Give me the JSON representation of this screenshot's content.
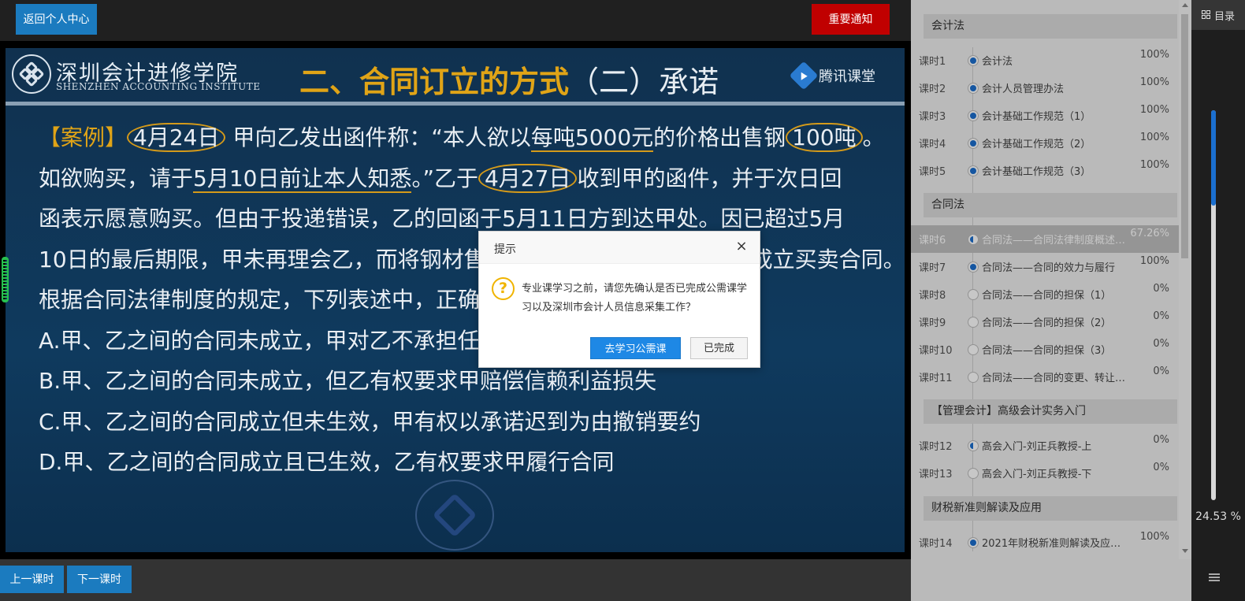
{
  "topbar": {
    "back_label": "返回个人中心",
    "notice_label": "重要通知"
  },
  "slide": {
    "institute_cn": "深圳会计进修学院",
    "institute_en": "SHENZHEN ACCOUNTING INSTITUTE",
    "title_main": "二、合同订立的方式",
    "title_sub": "（二）承诺",
    "brand": "腾讯课堂",
    "line1_tag": "【案例】",
    "line1_date": "4月24日",
    "line1_a": "甲向乙发出函件称：“本人欲以",
    "line1_price": "每吨5000元",
    "line1_b": "的价格出售钢",
    "line1_qty": "100吨",
    "line1_end": "。",
    "line2_a": "如欲购买，请于",
    "line2_deadline": "5月10日前让本人知悉",
    "line2_b": "。”乙于",
    "line2_date": "4月27日",
    "line2_c": "收到甲的函件，并于次日回",
    "line3": "函表示愿意购买。但由于投递错误，乙的回函于5月11日方到达甲处。因已超过5月",
    "line4": "10日的最后期限，甲未再理会乙，而将钢材售予丙。乙认为甲、乙之间已成立买卖合同。",
    "line5": "根据合同法律制度的规定，下列表述中，正确的是（ ）。",
    "option_a": "A.甲、乙之间的合同未成立，甲对乙不承担任何责任",
    "option_b": "B.甲、乙之间的合同未成立，但乙有权要求甲赔偿信赖利益损失",
    "option_c": "C.甲、乙之间的合同成立但未生效，甲有权以承诺迟到为由撤销要约",
    "option_d": "D.甲、乙之间的合同成立且已生效，乙有权要求甲履行合同"
  },
  "bottombar": {
    "prev_label": "上一课时",
    "next_label": "下一课时"
  },
  "playlist": {
    "sections": [
      {
        "title": "会计法",
        "lessons": [
          {
            "num": "课时1",
            "name": "会计法",
            "pct": "100%",
            "state": "full"
          },
          {
            "num": "课时2",
            "name": "会计人员管理办法",
            "pct": "100%",
            "state": "full"
          },
          {
            "num": "课时3",
            "name": "会计基础工作规范（1）",
            "pct": "100%",
            "state": "full"
          },
          {
            "num": "课时4",
            "name": "会计基础工作规范（2）",
            "pct": "100%",
            "state": "full"
          },
          {
            "num": "课时5",
            "name": "会计基础工作规范（3）",
            "pct": "100%",
            "state": "full"
          }
        ]
      },
      {
        "title": "合同法",
        "lessons": [
          {
            "num": "课时6",
            "name": "合同法——合同法律制度概述…",
            "pct": "67.26%",
            "state": "half"
          },
          {
            "num": "课时7",
            "name": "合同法——合同的效力与履行",
            "pct": "100%",
            "state": "full"
          },
          {
            "num": "课时8",
            "name": "合同法——合同的担保（1）",
            "pct": "0%",
            "state": "empty"
          },
          {
            "num": "课时9",
            "name": "合同法——合同的担保（2）",
            "pct": "0%",
            "state": "empty"
          },
          {
            "num": "课时10",
            "name": "合同法——合同的担保（3）",
            "pct": "0%",
            "state": "empty"
          },
          {
            "num": "课时11",
            "name": "合同法——合同的变更、转让…",
            "pct": "0%",
            "state": "empty"
          }
        ]
      },
      {
        "title": "【管理会计】高级会计实务入门",
        "lessons": [
          {
            "num": "课时12",
            "name": "高会入门-刘正兵教授-上",
            "pct": "0%",
            "state": "half"
          },
          {
            "num": "课时13",
            "name": "高会入门-刘正兵教授-下",
            "pct": "0%",
            "state": "empty"
          }
        ]
      },
      {
        "title": "财税新准则解读及应用",
        "lessons": [
          {
            "num": "课时14",
            "name": "2021年财税新准则解读及应…",
            "pct": "100%",
            "state": "full"
          }
        ]
      }
    ]
  },
  "rightstrip": {
    "toc_label": "目录",
    "overall_progress": "24.53 %",
    "overall_fraction": 0.2453
  },
  "dialog": {
    "title": "提示",
    "close_glyph": "×",
    "icon_glyph": "?",
    "message": "专业课学习之前，请您先确认是否已完成公需课学习以及深圳市会计人员信息采集工作？",
    "primary_label": "去学习公需课",
    "secondary_label": "已完成"
  },
  "colors": {
    "accent_blue": "#1b7bbf",
    "notice_red": "#c00000",
    "slide_gold": "#e0a417",
    "dialog_primary": "#1e88e5",
    "warning_icon": "#f0b400"
  }
}
